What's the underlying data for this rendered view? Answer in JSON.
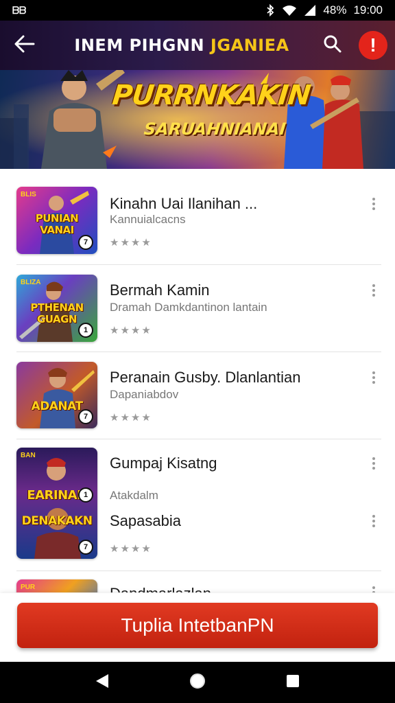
{
  "status_bar": {
    "left_text": "ᗷᗷ",
    "battery": "48%",
    "time": "19:00",
    "icons": [
      "bluetooth-icon",
      "wifi-icon",
      "signal-icon"
    ]
  },
  "app_bar": {
    "title_part1": "INEM PIHGNN",
    "title_part2": "JGANIEA",
    "back_icon": "back-arrow-icon",
    "search_icon": "search-icon",
    "alert_label": "!"
  },
  "banner": {
    "title": "PURRNKAKIN",
    "subtitle": "SARUAHNIANAI"
  },
  "games": [
    {
      "title": "Kinahn Uai Ilanihan ...",
      "subtitle": "Kannuialcacns",
      "thumb_label": "PUNIAN VANAI",
      "thumb_tag": "BLIS",
      "stars": "★★★★",
      "badge": "7"
    },
    {
      "title": "Bermah Kamin",
      "subtitle": "Dramah Damkdantinon lantain",
      "thumb_label": "PTHENAN GUAGN",
      "thumb_tag": "BLIZA",
      "stars": "★★★★",
      "badge": "1"
    },
    {
      "title": "Peranain Gusby. Dlanlantian",
      "subtitle": "Dapaniabdov",
      "thumb_label": "ADANAT",
      "thumb_tag": "",
      "stars": "★★★★",
      "badge": "7"
    },
    {
      "title": "Gumpaj Kisatng",
      "subtitle": "Atakdalm",
      "extra": "Sapasabia",
      "thumb_label_1": "EARINAN",
      "thumb_label_2": "DENAKAKN",
      "thumb_tag": "BAN",
      "stars": "★★★★",
      "badge": "1",
      "badge2": "7"
    },
    {
      "title": "Dandmarlazlan",
      "thumb_tag": "PUR"
    }
  ],
  "cta": {
    "label": "Tuplia IntetbanPN"
  },
  "nav_bar": {
    "icons": [
      "back-triangle-icon",
      "home-circle-icon",
      "recents-square-icon"
    ]
  },
  "colors": {
    "accent_red": "#d62a17",
    "alert_red": "#e3241b",
    "title_yellow": "#f5c518"
  }
}
